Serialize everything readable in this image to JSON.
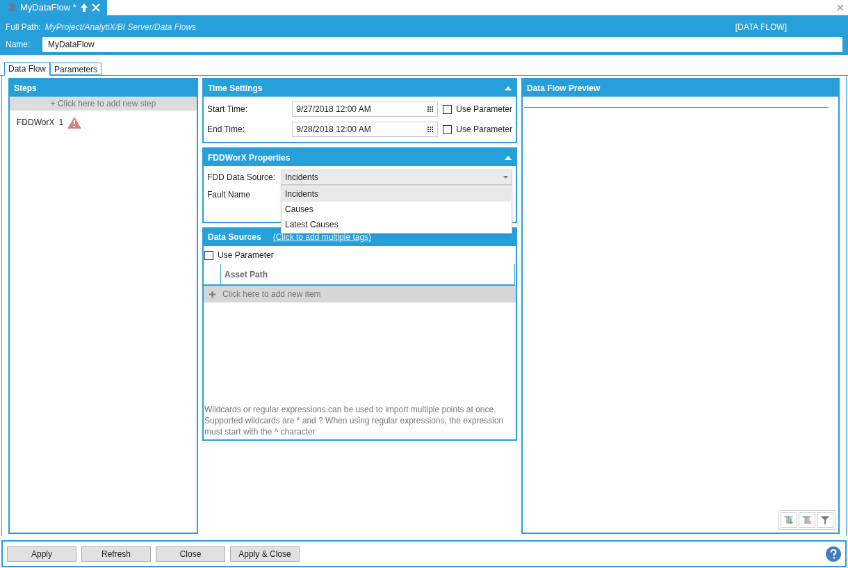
{
  "document_tab": {
    "title": "MyDataFlow *"
  },
  "header": {
    "full_path_label": "Full Path:",
    "full_path": "MyProject/AnalytiX/BI Server/Data Flows",
    "type_label": "[DATA FLOW]",
    "name_label": "Name:",
    "name_value": "MyDataFlow"
  },
  "tabs": [
    {
      "label": "Data Flow",
      "selected": true
    },
    {
      "label": "Parameters",
      "selected": false
    }
  ],
  "steps": {
    "title": "Steps",
    "add_step": "+  Click here to add new step",
    "items": [
      {
        "name": "FDDWorX",
        "index": "1",
        "warning": true
      }
    ]
  },
  "time_settings": {
    "title": "Time Settings",
    "expanded": true,
    "rows": [
      {
        "label": "Start Time:",
        "value": "9/27/2018 12:00 AM",
        "use_parameter": "Use Parameter",
        "checked": false
      },
      {
        "label": "End Time:",
        "value": "9/28/2018 12:00 AM",
        "use_parameter": "Use Parameter",
        "checked": false
      }
    ]
  },
  "fddworx_properties": {
    "title": "FDDWorX Properties",
    "expanded": true,
    "data_source_label": "FDD Data Source:",
    "data_source_value": "Incidents",
    "fault_name_label": "Fault Name",
    "dropdown_options": [
      {
        "label": "Incidents",
        "selected": true
      },
      {
        "label": "Causes",
        "selected": false
      },
      {
        "label": "Latest Causes",
        "selected": false
      }
    ]
  },
  "data_sources": {
    "title": "Data Sources",
    "link": "(Click to add multiple tags)",
    "use_parameter": "Use Parameter",
    "checked": false,
    "columns": [
      "Asset Path"
    ],
    "add_item": "Click here to add new item",
    "help_text": "Wildcards or regular expressions can be used to import multiple points at once. Supported wildcards are * and ? When using regular expressions, the expression must start with the ^ character"
  },
  "preview": {
    "title": "Data Flow Preview"
  },
  "buttons": [
    "Apply",
    "Refresh",
    "Close",
    "Apply & Close"
  ]
}
